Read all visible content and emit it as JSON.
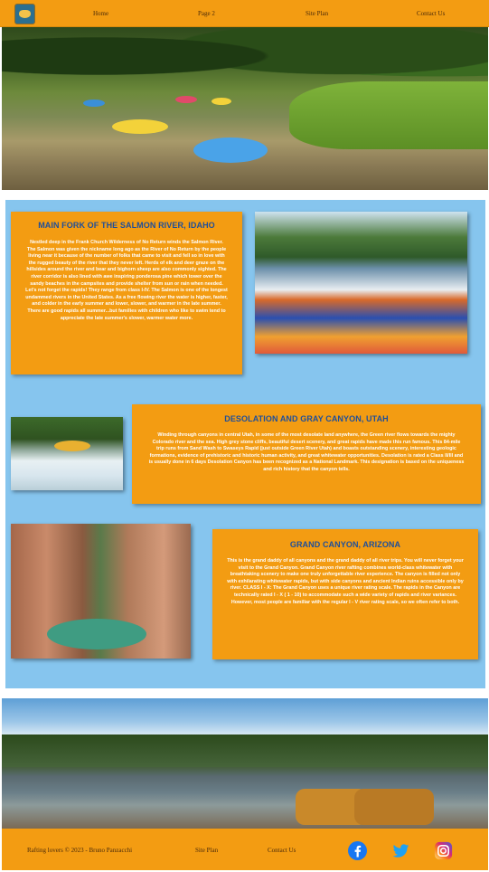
{
  "nav": {
    "items": [
      "Home",
      "Page 2",
      "Site Plan",
      "Contact Us"
    ]
  },
  "sections": [
    {
      "title": "MAIN FORK OF THE SALMON RIVER, IDAHO",
      "text": "Nestled deep in the Frank Church Wilderness of No Return winds the Salmon River. The Salmon was given the nickname long ago as the River of No Return by the people living near it because of the number of folks that came to visit and fell so in love with the rugged beauty of the river that they never left. Herds of elk and deer graze on the hillsides around the river and bear and bighorn sheep are also commonly sighted. The river corridor is also lined with awe inspiring ponderosa pine which tower over the sandy beaches in the campsites and provide shelter from sun or rain when needed. Let's not forget the rapids! They range from class I-IV. The Salmon is one of the longest undammed rivers in the United States. As a free flowing river the water is higher, faster, and colder in the early summer and lower, slower, and warmer in the late summer. There are good rapids all summer...but families with children who like to swim tend to appreciate the late summer's slower, warmer water more."
    },
    {
      "title": "DESOLATION AND GRAY CANYON, UTAH",
      "text": "Winding through canyons in central Utah, in some of the most desolate land anywhere, the Green river flows towards the mighty Colorado river and the sea. High grey stone cliffs, beautiful desert scenery, and great rapids have made this run famous. This 84-mile trip runs from Sand Wash to Swaseys Rapid (just outside Green River Utah) and boasts outstanding scenery, interesting geologic formations, evidence of prehistoric and historic human activity, and great whitewater opportunities. Desolation is rated a Class II/III and is usually done in 6 days Desolation Canyon has been recognized as a National Landmark. This designation is based on the uniqueness and rich history that the canyon tells."
    },
    {
      "title": "GRAND CANYON, ARIZONA",
      "text": "This is the grand daddy of all canyons and the grand daddy of all river trips. You will never forget your visit to the Grand Canyon. Grand Canyon river rafting combines world-class whitewater with breathtaking scenery to make one truly unforgettable river experience. The canyon is filled not only with exhilarating whitewater rapids, but with side canyons and ancient Indian ruins accessible only by river. CLASS I - X: The Grand Canyon uses a unique river rating scale. The rapids in the Canyon are technically rated I - X ( 1 - 10) to accommodate such a wide variety of rapids and river variances. However, most people are familiar with the regular I - V river rating scale, so we often refer to both."
    }
  ],
  "footer": {
    "copyright": "Rafting lovers © 2023 - Bruno Panzacchi",
    "site_plan": "Site Plan",
    "contact": "Contact Us"
  },
  "colors": {
    "accent": "#f39c12",
    "panel": "#86c5ee",
    "heading": "#1f4f9a"
  },
  "icons": [
    "facebook-icon",
    "twitter-icon",
    "instagram-icon"
  ]
}
